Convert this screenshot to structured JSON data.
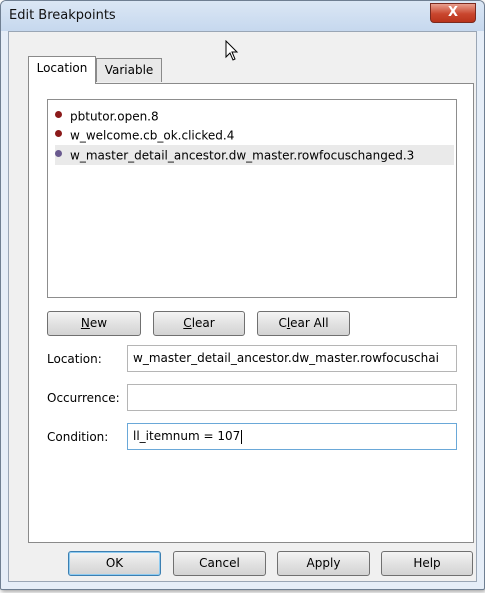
{
  "window": {
    "title": "Edit Breakpoints",
    "close_label": "X"
  },
  "tabs": [
    {
      "label": "Location",
      "selected": true
    },
    {
      "label": "Variable",
      "selected": false
    }
  ],
  "breakpoints": [
    {
      "label": "pbtutor.open.8",
      "dot_color": "#8b1a1a",
      "selected": false
    },
    {
      "label": "w_welcome.cb_ok.clicked.4",
      "dot_color": "#8b1a1a",
      "selected": false
    },
    {
      "label": "w_master_detail_ancestor.dw_master.rowfocuschanged.3",
      "dot_color": "#6a5a8f",
      "selected": true
    }
  ],
  "list_buttons": {
    "new_rest": "ew",
    "new_mnemonic": "N",
    "clear_rest": "lear",
    "clear_mnemonic": "C",
    "clear_all_pre": "C",
    "clear_all_mnemonic": "l",
    "clear_all_rest": "ear All"
  },
  "fields": {
    "location_label": "Location:",
    "location_value": "w_master_detail_ancestor.dw_master.rowfocuschai",
    "occurrence_label": "Occurrence:",
    "occurrence_value": "",
    "condition_label": "Condition:",
    "condition_value": "ll_itemnum = 107"
  },
  "dialog_buttons": {
    "ok": "OK",
    "cancel": "Cancel",
    "apply": "Apply",
    "help": "Help"
  }
}
